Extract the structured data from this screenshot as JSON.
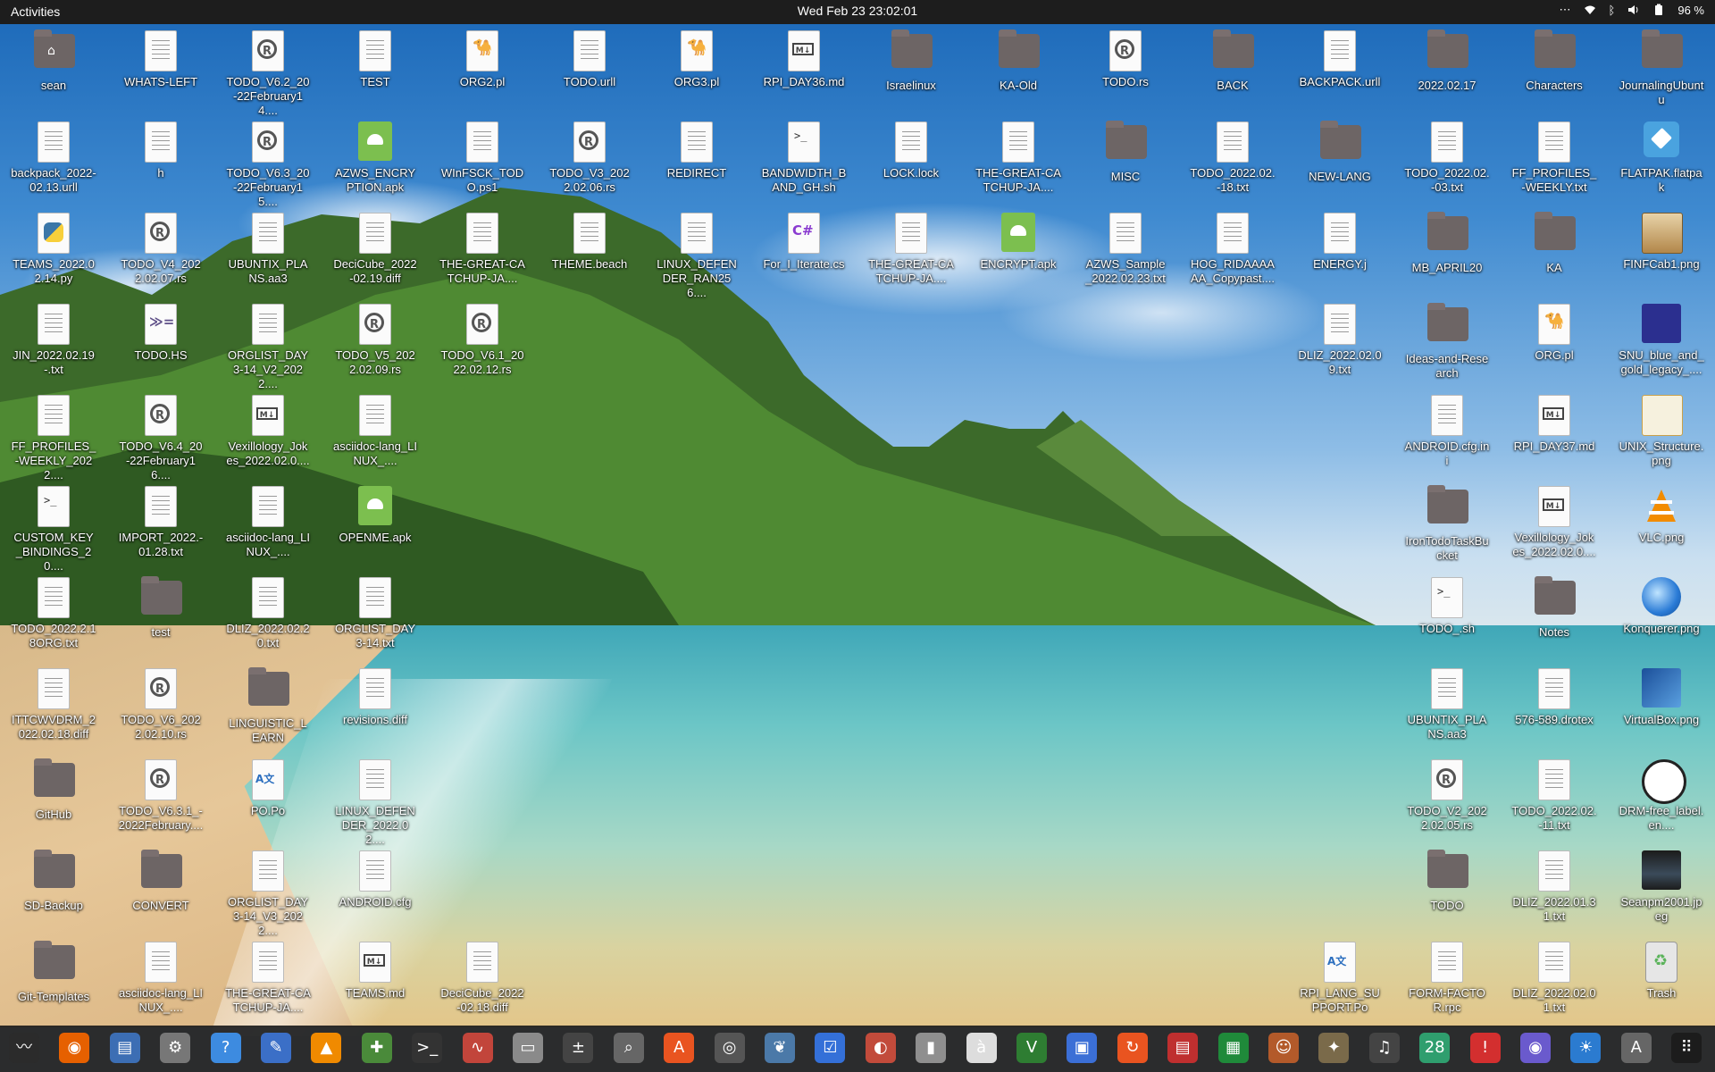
{
  "topbar": {
    "activities": "Activities",
    "clock": "Wed Feb 23  23:02:01",
    "battery": "96 %",
    "tray_icons": [
      "more-icon",
      "wifi-icon",
      "bluetooth-icon",
      "volume-icon",
      "battery-icon"
    ]
  },
  "desktop": {
    "icons": [
      {
        "label": "sean",
        "type": "folder-home"
      },
      {
        "label": "WHATS-LEFT",
        "type": "doc"
      },
      {
        "label": "TODO_V6.2_20-22February14....",
        "type": "rs"
      },
      {
        "label": "TEST",
        "type": "doc"
      },
      {
        "label": "ORG2.pl",
        "type": "pl"
      },
      {
        "label": "TODO.urll",
        "type": "doc"
      },
      {
        "label": "ORG3.pl",
        "type": "pl"
      },
      {
        "label": "RPI_DAY36.md",
        "type": "md"
      },
      {
        "label": "Israelinux",
        "type": "folder"
      },
      {
        "label": "KA-Old",
        "type": "folder"
      },
      {
        "label": "TODO.rs",
        "type": "rs"
      },
      {
        "label": "BACK",
        "type": "folder"
      },
      {
        "label": "BACKPACK.urll",
        "type": "doc"
      },
      {
        "label": "2022.02.17",
        "type": "folder"
      },
      {
        "label": "Characters",
        "type": "folder"
      },
      {
        "label": "JournalingUbuntu",
        "type": "folder"
      },
      {
        "label": "backpack_2022-02.13.urll",
        "type": "doc"
      },
      {
        "label": "h",
        "type": "doc"
      },
      {
        "label": "TODO_V6.3_20-22February15....",
        "type": "rs"
      },
      {
        "label": "AZWS_ENCRYPTION.apk",
        "type": "apk"
      },
      {
        "label": "WInFSCK_TODO.ps1",
        "type": "doc"
      },
      {
        "label": "TODO_V3_2022.02.06.rs",
        "type": "rs"
      },
      {
        "label": "REDIRECT",
        "type": "doc"
      },
      {
        "label": "BANDWIDTH_BAND_GH.sh",
        "type": "sh"
      },
      {
        "label": "LOCK.lock",
        "type": "doc"
      },
      {
        "label": "THE-GREAT-CATCHUP-JA....",
        "type": "doc"
      },
      {
        "label": "MISC",
        "type": "folder"
      },
      {
        "label": "TODO_2022.02.-18.txt",
        "type": "doc"
      },
      {
        "label": "NEW-LANG",
        "type": "folder"
      },
      {
        "label": "TODO_2022.02.-03.txt",
        "type": "doc"
      },
      {
        "label": "FF_PROFILES_-WEEKLY.txt",
        "type": "doc"
      },
      {
        "label": "FLATPAK.flatpak",
        "type": "flatpak"
      },
      {
        "label": "TEAMS_2022.02.14.py",
        "type": "py"
      },
      {
        "label": "TODO_V4_2022.02.07.rs",
        "type": "rs"
      },
      {
        "label": "UBUNTIX_PLANS.aa3",
        "type": "doc"
      },
      {
        "label": "DeciCube_2022-02.19.diff",
        "type": "doc"
      },
      {
        "label": "THE-GREAT-CATCHUP-JA....",
        "type": "doc"
      },
      {
        "label": "THEME.beach",
        "type": "doc"
      },
      {
        "label": "LINUX_DEFENDER_RAN256....",
        "type": "doc"
      },
      {
        "label": "For_I_Iterate.cs",
        "type": "cs"
      },
      {
        "label": "THE-GREAT-CATCHUP-JA....",
        "type": "doc"
      },
      {
        "label": "ENCRYPT.apk",
        "type": "apk"
      },
      {
        "label": "AZWS_Sample_2022.02.23.txt",
        "type": "doc"
      },
      {
        "label": "HOG_RIDAAAAAA_Copypast....",
        "type": "doc"
      },
      {
        "label": "ENERGY.j",
        "type": "doc"
      },
      {
        "label": "MB_APRIL20",
        "type": "folder"
      },
      {
        "label": "KA",
        "type": "folder"
      },
      {
        "label": "FINFCab1.png",
        "type": "img-cabinet"
      },
      {
        "label": "JIN_2022.02.19-.txt",
        "type": "doc"
      },
      {
        "label": "TODO.HS",
        "type": "hs"
      },
      {
        "label": "ORGLIST_DAY3-14_V2_2022....",
        "type": "doc"
      },
      {
        "label": "TODO_V5_2022.02.09.rs",
        "type": "rs"
      },
      {
        "label": "TODO_V6.1_2022.02.12.rs",
        "type": "rs"
      },
      {
        "label": "DLIZ_2022.02.09.txt",
        "type": "doc"
      },
      {
        "label": "Ideas-and-Research",
        "type": "folder"
      },
      {
        "label": "ORG.pl",
        "type": "pl"
      },
      {
        "label": "SNU_blue_and_gold_legacy_....",
        "type": "img-snu"
      },
      {
        "label": "FF_PROFILES_-WEEKLY_2022....",
        "type": "doc"
      },
      {
        "label": "TODO_V6.4_20-22February16....",
        "type": "rs"
      },
      {
        "label": "Vexillology_Jokes_2022.02.0....",
        "type": "md"
      },
      {
        "label": "asciidoc-lang_LINUX_....",
        "type": "doc"
      },
      {
        "label": "ANDROID.cfg.ini",
        "type": "doc"
      },
      {
        "label": "RPI_DAY37.md",
        "type": "md"
      },
      {
        "label": "UNIX_Structure.png",
        "type": "img-unix"
      },
      {
        "label": "CUSTOM_KEY_BINDINGS_20....",
        "type": "sh"
      },
      {
        "label": "IMPORT_2022.-01.28.txt",
        "type": "doc"
      },
      {
        "label": "asciidoc-lang_LINUX_....",
        "type": "doc"
      },
      {
        "label": "OPENME.apk",
        "type": "apk"
      },
      {
        "label": "IronTodoTaskBucket",
        "type": "folder"
      },
      {
        "label": "Vexillology_Jokes_2022.02.0....",
        "type": "md"
      },
      {
        "label": "VLC.png",
        "type": "img-vlc"
      },
      {
        "label": "TODO_2022.2.18ORG.txt",
        "type": "doc"
      },
      {
        "label": "test",
        "type": "folder"
      },
      {
        "label": "DLIZ_2022.02.20.txt",
        "type": "doc"
      },
      {
        "label": "ORGLIST_DAY3-14.txt",
        "type": "doc"
      },
      {
        "label": "TODO_.sh",
        "type": "sh"
      },
      {
        "label": "Notes",
        "type": "folder"
      },
      {
        "label": "Konquerer.png",
        "type": "img-konq"
      },
      {
        "label": "ITTCWVDRM_2022.02.18.diff",
        "type": "doc"
      },
      {
        "label": "TODO_V6_2022.02.10.rs",
        "type": "rs"
      },
      {
        "label": "LINGUISTIC_LEARN",
        "type": "folder"
      },
      {
        "label": "revisions.diff",
        "type": "doc"
      },
      {
        "label": "UBUNTIX_PLANS.aa3",
        "type": "doc"
      },
      {
        "label": "576-589.drotex",
        "type": "doc"
      },
      {
        "label": "VirtualBox.png",
        "type": "img-vbox"
      },
      {
        "label": "GitHub",
        "type": "folder"
      },
      {
        "label": "TODO_V6.3.1_-2022February....",
        "type": "rs"
      },
      {
        "label": "PO.Po",
        "type": "po"
      },
      {
        "label": "LINUX_DEFENDER_2022.02....",
        "type": "doc"
      },
      {
        "label": "TODO_V2_2022.02.05.rs",
        "type": "rs"
      },
      {
        "label": "TODO_2022.02.-11.txt",
        "type": "doc"
      },
      {
        "label": "DRM-free_label.en....",
        "type": "img-drm"
      },
      {
        "label": "SD-Backup",
        "type": "folder"
      },
      {
        "label": "CONVERT",
        "type": "folder"
      },
      {
        "label": "ORGLIST_DAY3-14_V3_2022....",
        "type": "doc"
      },
      {
        "label": "ANDROID.cfg",
        "type": "doc"
      },
      {
        "label": "TODO",
        "type": "folder"
      },
      {
        "label": "DLIZ_2022.01.31.txt",
        "type": "doc"
      },
      {
        "label": "Seanpm2001.jpeg",
        "type": "img-photo"
      },
      {
        "label": "Git-Templates",
        "type": "folder"
      },
      {
        "label": "asciidoc-lang_LINUX_....",
        "type": "doc"
      },
      {
        "label": "THE-GREAT-CATCHUP-JA....",
        "type": "doc"
      },
      {
        "label": "TEAMS.md",
        "type": "md"
      },
      {
        "label": "DeciCube_2022-02.18.diff",
        "type": "doc"
      },
      {
        "label": "RPI_LANG_SUPPORT.Po",
        "type": "po"
      },
      {
        "label": "FORM-FACTOR.rpc",
        "type": "doc"
      },
      {
        "label": "DLIZ_2022.02.01.txt",
        "type": "doc"
      },
      {
        "label": "Trash",
        "type": "trash"
      }
    ]
  },
  "dock": {
    "apps": [
      {
        "name": "system-monitor-icon",
        "glyph": "〰",
        "color": "#2b2b2b"
      },
      {
        "name": "firefox-icon",
        "glyph": "◉",
        "color": "#e66000"
      },
      {
        "name": "text-editor-icon",
        "glyph": "▤",
        "color": "#3c6eb4"
      },
      {
        "name": "settings-icon",
        "glyph": "⚙",
        "color": "#777777"
      },
      {
        "name": "help-icon",
        "glyph": "?",
        "color": "#3d8be0"
      },
      {
        "name": "notes-icon",
        "glyph": "✎",
        "color": "#3b6fc7"
      },
      {
        "name": "vlc-icon",
        "glyph": "▲",
        "color": "#f08a00"
      },
      {
        "name": "add-app-icon",
        "glyph": "✚",
        "color": "#4a8a3a"
      },
      {
        "name": "terminal-icon",
        "glyph": ">_",
        "color": "#333333"
      },
      {
        "name": "pulse-icon",
        "glyph": "∿",
        "color": "#c2453b"
      },
      {
        "name": "files-icon",
        "glyph": "▭",
        "color": "#8a8a8a"
      },
      {
        "name": "calculator-icon",
        "glyph": "±",
        "color": "#444444"
      },
      {
        "name": "search-icon",
        "glyph": "⌕",
        "color": "#666666"
      },
      {
        "name": "software-icon",
        "glyph": "A",
        "color": "#e95420"
      },
      {
        "name": "disk-icon",
        "glyph": "◎",
        "color": "#555555"
      },
      {
        "name": "books-icon",
        "glyph": "❦",
        "color": "#4b79a8"
      },
      {
        "name": "tasks-icon",
        "glyph": "☑",
        "color": "#3470d8"
      },
      {
        "name": "document-viewer-icon",
        "glyph": "◐",
        "color": "#c24b3b"
      },
      {
        "name": "archive-icon",
        "glyph": "▮",
        "color": "#8f8f8f"
      },
      {
        "name": "character-map-icon",
        "glyph": "à",
        "color": "#dddddd"
      },
      {
        "name": "vim-icon",
        "glyph": "V",
        "color": "#2e7d32"
      },
      {
        "name": "screens-icon",
        "glyph": "▣",
        "color": "#3b6fd6"
      },
      {
        "name": "update-icon",
        "glyph": "↻",
        "color": "#e95420"
      },
      {
        "name": "pdf-icon",
        "glyph": "▤",
        "color": "#bf2f2f"
      },
      {
        "name": "spreadsheet-icon",
        "glyph": "▦",
        "color": "#1f8a3a"
      },
      {
        "name": "game-icon",
        "glyph": "☺",
        "color": "#b35a2a"
      },
      {
        "name": "gimp-icon",
        "glyph": "✦",
        "color": "#7a6a4a"
      },
      {
        "name": "music-icon",
        "glyph": "♫",
        "color": "#444444"
      },
      {
        "name": "calendar-icon",
        "glyph": "28",
        "color": "#2f9e6e"
      },
      {
        "name": "alert-icon",
        "glyph": "!",
        "color": "#d32f2f"
      },
      {
        "name": "screenshot-icon",
        "glyph": "◉",
        "color": "#6a5acd"
      },
      {
        "name": "weather-icon",
        "glyph": "☀",
        "color": "#2b7bd0"
      },
      {
        "name": "ubuntu-software-icon",
        "glyph": "A",
        "color": "#666666"
      },
      {
        "name": "app-grid-icon",
        "glyph": "⠿",
        "color": "#1c1c1c"
      }
    ]
  }
}
